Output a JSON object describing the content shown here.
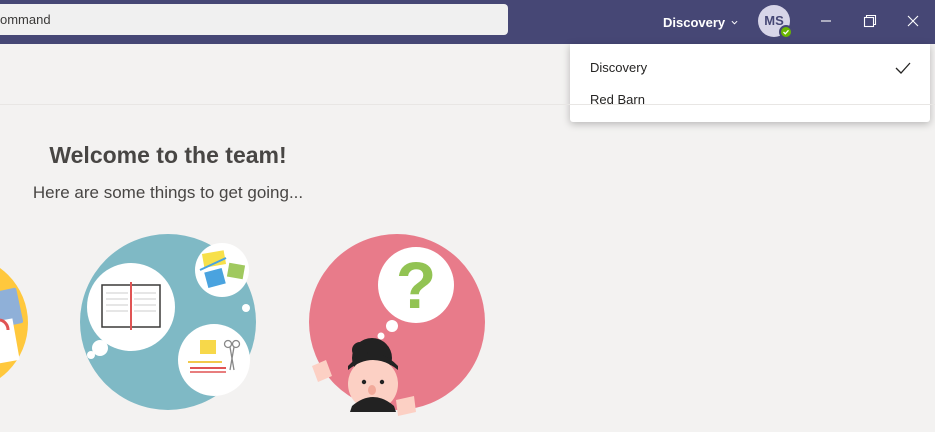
{
  "titlebar": {
    "search_text": "ommand",
    "org_name": "Discovery",
    "avatar_initials": "MS"
  },
  "org_menu": {
    "items": [
      {
        "label": "Discovery",
        "selected": true
      },
      {
        "label": "Red Barn",
        "selected": false
      }
    ]
  },
  "welcome": {
    "title": "Welcome to the team!",
    "subtitle": "Here are some things to get going..."
  },
  "colors": {
    "titlebar": "#464775",
    "accent_yellow": "#ffc83d",
    "accent_teal": "#7fb9c5",
    "accent_pink": "#e87b8a"
  }
}
